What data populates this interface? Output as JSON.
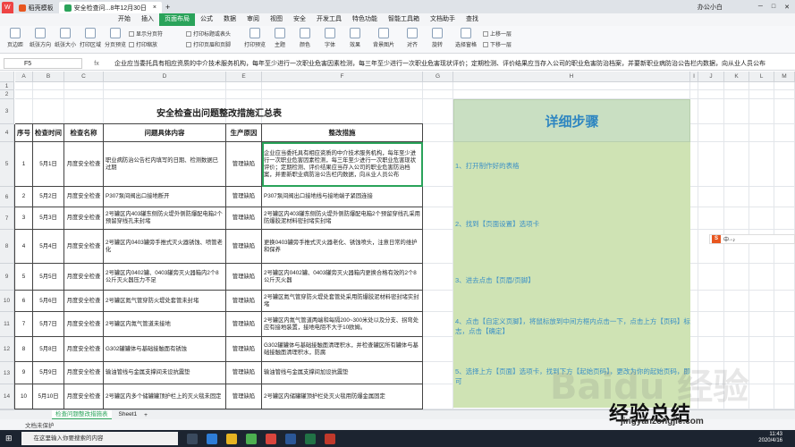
{
  "titlebar": {
    "tabs": [
      {
        "label": "稻壳模板",
        "active": false
      },
      {
        "label": "安全检查问...8年12月30日",
        "active": true
      }
    ],
    "user": "办公小白"
  },
  "menu": [
    "开始",
    "插入",
    "页面布局",
    "公式",
    "数据",
    "审阅",
    "视图",
    "安全",
    "开发工具",
    "特色功能",
    "智能工具箱",
    "文档助手",
    "查找"
  ],
  "menu_active": "页面布局",
  "ribbon": {
    "buttons": [
      "页边距",
      "纸张方向",
      "纸张大小",
      "打印区域",
      "分页预览"
    ],
    "opts": [
      "显示分页符",
      "打印标题或表头",
      "打印缩放",
      "打印页眉和页脚"
    ],
    "opts2": [
      "打印网格线",
      "打印预览"
    ],
    "right": [
      "主题",
      "颜色",
      "字体",
      "效果",
      "背景图片",
      "对齐",
      "旋转",
      "选择窗格",
      "上移一层",
      "下移一层",
      "组合"
    ]
  },
  "formula": {
    "namebox": "F5",
    "fx": "fx",
    "content": "企业应当委托具有相应资质的中介技术服务机构，每年至少进行一次职业危害因素检测，每三年至少进行一次职业危害现状评价；定期检测、评价结果应当存入公司的职业危害防治档案，并要新职业病防治公告栏内数据，向从业人员公布"
  },
  "columns": [
    "A",
    "B",
    "C",
    "D",
    "E",
    "F",
    "G",
    "H",
    "I",
    "J",
    "K",
    "L",
    "M"
  ],
  "sheet": {
    "title": "安全检查出问题整改措施汇总表",
    "headers": [
      "序号",
      "检查时间",
      "检查名称",
      "问题具体内容",
      "生产原因",
      "整改措施"
    ],
    "rows": [
      {
        "rownum": "5",
        "no": "1",
        "date": "5月1日",
        "name": "月度安全检查",
        "issue": "职业病防治公告栏内填写的日期、检测数据已过期",
        "cause": "管理缺陷",
        "fix": "企业应当委托具有相应资质的中介技术服务机构，每年至少进行一次职业危害因素检测，每三年至少进行一次职业危害现状评价；定期检测、评价结果应当存入公司的职业危害防治档案，并要新职业病防治公告栏内数据，向从业人员公布"
      },
      {
        "rownum": "6",
        "no": "2",
        "date": "5月2日",
        "name": "月度安全检查",
        "issue": "P307泵间阀出口接地断开",
        "cause": "管理缺陷",
        "fix": "P307泵间阀出口接地线与接地端子紧固连接"
      },
      {
        "rownum": "7",
        "no": "3",
        "date": "5月3日",
        "name": "月度安全检查",
        "issue": "2号罐区内403罐东侧防火堤外侧防爆配电箱2个预留穿线孔未封堵",
        "cause": "管理缺陷",
        "fix": "2号罐区内403罐东侧防火堤外侧防爆配电箱2个预留穿线孔采用防爆胶泥材料密封堵实封堵"
      },
      {
        "rownum": "8",
        "no": "4",
        "date": "5月4日",
        "name": "月度安全检查",
        "issue": "2号罐区内0403罐旁手推式灭火器锈蚀、喷管老化",
        "cause": "管理缺陷",
        "fix": "更换0403罐旁手推式灭火器老化、锈蚀喷头，注意日常的维护和保养"
      },
      {
        "rownum": "9",
        "no": "5",
        "date": "5月5日",
        "name": "月度安全检查",
        "issue": "2号罐区内0402罐、0403罐旁灭火器箱内2个8公斤灭火器压力不足",
        "cause": "管理缺陷",
        "fix": "2号罐区内0402罐、0403罐旁灭火器箱内更换合格有效的2个8公斤灭火器"
      },
      {
        "rownum": "10",
        "no": "6",
        "date": "5月6日",
        "name": "月度安全检查",
        "issue": "2号罐区氮气管穿防火堤处套管未封堵",
        "cause": "管理缺陷",
        "fix": "2号罐区氮气管穿防火堤处套管处采用防爆胶泥材料密封堵实封堵"
      },
      {
        "rownum": "11",
        "no": "7",
        "date": "5月7日",
        "name": "月度安全检查",
        "issue": "2号罐区内氮气管道未接地",
        "cause": "管理缺陷",
        "fix": "2号罐区内氮气管道两端和每隔200~300米处以及分支、拐弯处应有接地装置，接地电阻不大于10欧姆。"
      },
      {
        "rownum": "12",
        "no": "8",
        "date": "5月8日",
        "name": "月度安全检查",
        "issue": "G302罐罐体与基础接触面有锈蚀",
        "cause": "管理缺陷",
        "fix": "G302罐罐体与基础接触面清理积水，并检查罐区所有罐体与基础接触面清理积水，防腐"
      },
      {
        "rownum": "13",
        "no": "9",
        "date": "5月9日",
        "name": "月度安全检查",
        "issue": "输油管线与金属支撑间未设抗震垫",
        "cause": "管理缺陷",
        "fix": "输油管线与金属支撑间加设抗震垫"
      },
      {
        "rownum": "14",
        "no": "10",
        "date": "5月10日",
        "name": "月度安全检查",
        "issue": "2号罐区内多个储罐罐顶护栏上的灭火毯未固定",
        "cause": "管理缺陷",
        "fix": "2号罐区内储罐罐顶护栏处灭火毯用防爆金属固定"
      }
    ]
  },
  "guide": {
    "title": "详细步骤",
    "steps": [
      "1、打开制作好的表格",
      "2、找到【页面设置】选项卡",
      "3、进去点击【页眉/页脚】",
      "4、点击【自定义页脚】，将鼠标放到中间方框内点击一下，点击上方【页码】标志，点击【确定】",
      "5、选择上方【页面】选项卡，找到下方【起始页码】，更改为你的起始页码，即可"
    ]
  },
  "sheet_tabs": [
    {
      "label": "检查问题整改措施表",
      "active": true
    },
    {
      "label": "Sheet1",
      "active": false
    }
  ],
  "status": "文档未保护",
  "taskbar": {
    "search_placeholder": "在这里输入你要搜索的内容",
    "time": "11:43",
    "date": "2020/4/16"
  },
  "watermark": {
    "main": "经验总结",
    "url": "jingyanzongjie.com",
    "baidu": "Baidu 经验"
  },
  "ime": "中·◦♪"
}
